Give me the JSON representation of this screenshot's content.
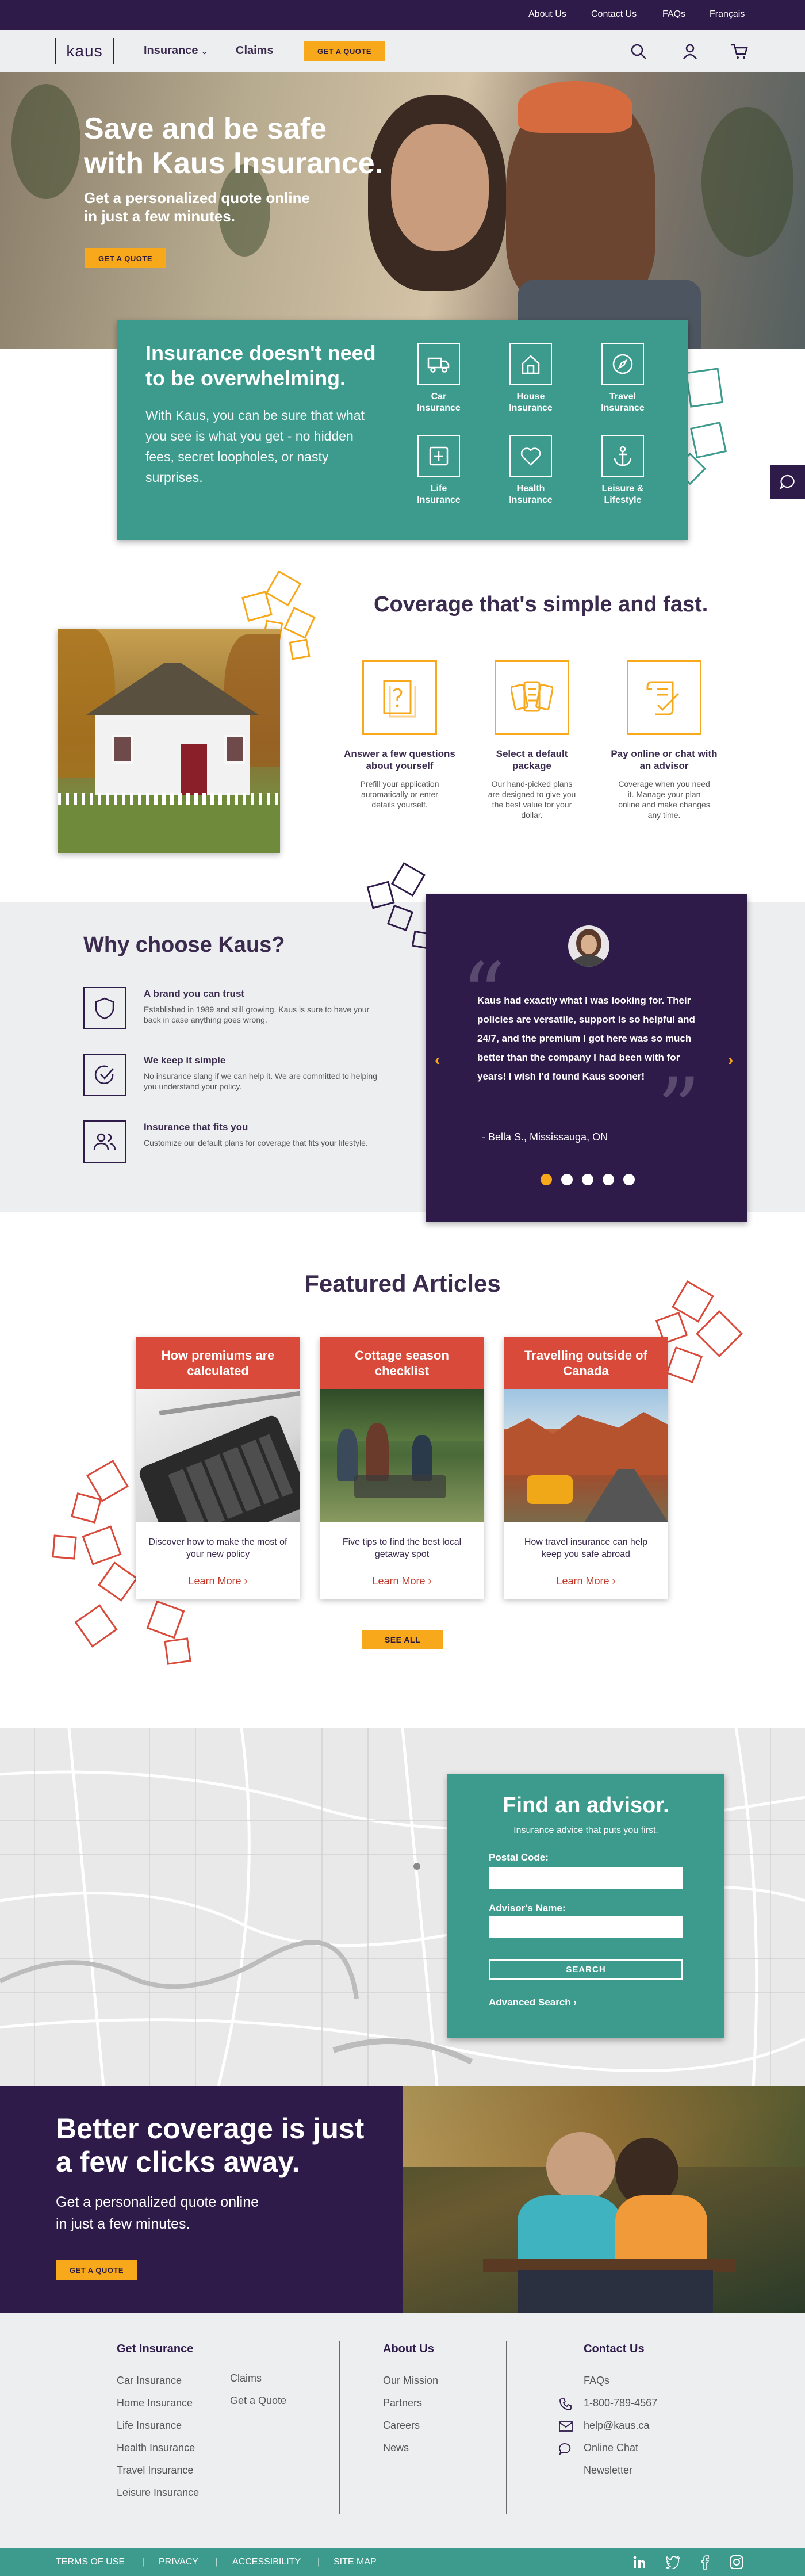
{
  "topbar": {
    "links": [
      "About Us",
      "Contact Us",
      "FAQs",
      "Français"
    ]
  },
  "nav": {
    "logo": "kaus",
    "insurance": "Insurance",
    "claims": "Claims",
    "cta": "GET A QUOTE"
  },
  "hero": {
    "title_line1": "Save and be safe",
    "title_line2": "with Kaus Insurance.",
    "subtitle_line1": "Get a personalized quote online",
    "subtitle_line2": "in just a few minutes.",
    "cta": "GET A QUOTE"
  },
  "insbox": {
    "title_line1": "Insurance doesn't need",
    "title_line2": "to be overwhelming.",
    "body": "With Kaus, you can be sure that what you see is what you get - no hidden fees, secret loopholes, or nasty surprises.",
    "items": [
      {
        "l1": "Car",
        "l2": "Insurance",
        "icon": "truck-icon"
      },
      {
        "l1": "House",
        "l2": "Insurance",
        "icon": "house-icon"
      },
      {
        "l1": "Travel",
        "l2": "Insurance",
        "icon": "compass-icon"
      },
      {
        "l1": "Life",
        "l2": "Insurance",
        "icon": "plus-square-icon"
      },
      {
        "l1": "Health",
        "l2": "Insurance",
        "icon": "heart-icon"
      },
      {
        "l1": "Leisure &",
        "l2": "Lifestyle",
        "icon": "anchor-icon"
      }
    ]
  },
  "coverage": {
    "title": "Coverage that's simple and fast.",
    "steps": [
      {
        "t1": "Answer a few questions",
        "t2": "about yourself",
        "d": "Prefill your application automatically or enter details yourself."
      },
      {
        "t1": "Select a default",
        "t2": "package",
        "d": "Our hand-picked plans are designed to give you the best value for your dollar."
      },
      {
        "t1": "Pay online or chat with",
        "t2": "an advisor",
        "d": "Coverage when you need it. Manage your plan online and make changes any time."
      }
    ]
  },
  "why": {
    "title": "Why choose Kaus?",
    "items": [
      {
        "t": "A brand you can trust",
        "d": "Established in 1989 and still growing, Kaus is sure to have your back in case anything goes wrong."
      },
      {
        "t": "We keep it simple",
        "d": "No insurance slang if we can help it. We are committed to helping you understand your policy."
      },
      {
        "t": "Insurance that fits you",
        "d": "Customize our default plans for coverage that fits your lifestyle."
      }
    ]
  },
  "testimonial": {
    "quote": "Kaus had exactly what I was looking for. Their policies are versatile, support is so helpful and 24/7, and the premium I got here was so much better than the company I had been with for years! I wish I'd found Kaus sooner!",
    "author": "- Bella S., Mississauga, ON",
    "dots": 5,
    "active_dot": 0
  },
  "articles": {
    "title": "Featured Articles",
    "cards": [
      {
        "h": "How premiums are calculated",
        "d": "Discover how to make the most of your new policy",
        "more": "Learn More"
      },
      {
        "h": "Cottage season checklist",
        "d": "Five tips to find the best local getaway spot",
        "more": "Learn More"
      },
      {
        "h": "Travelling outside of Canada",
        "d": "How travel insurance can help keep you safe abroad",
        "more": "Learn More"
      }
    ],
    "see_all": "SEE ALL"
  },
  "advisor": {
    "title": "Find an advisor.",
    "subtitle": "Insurance advice that puts you first.",
    "postal_label": "Postal Code:",
    "name_label": "Advisor's Name:",
    "search": "SEARCH",
    "advanced": "Advanced Search"
  },
  "better": {
    "title_line1": "Better coverage is just",
    "title_line2": "a few clicks away.",
    "sub_line1": "Get a personalized quote online",
    "sub_line2": "in just a few minutes.",
    "cta": "GET A QUOTE"
  },
  "footer": {
    "col1_title": "Get Insurance",
    "col1_a": [
      "Car Insurance",
      "Home Insurance",
      "Life Insurance",
      "Health Insurance",
      "Travel Insurance",
      "Leisure Insurance"
    ],
    "col1_b": [
      "Claims",
      "Get a Quote"
    ],
    "col2_title": "About Us",
    "col2": [
      "Our Mission",
      "Partners",
      "Careers",
      "News"
    ],
    "col3_title": "Contact Us",
    "faqs": "FAQs",
    "phone": "1-800-789-4567",
    "email": "help@kaus.ca",
    "chat": "Online Chat",
    "newsletter": "Newsletter"
  },
  "legal": {
    "links": [
      "TERMS OF USE",
      "PRIVACY",
      "ACCESSIBILITY",
      "SITE MAP"
    ]
  },
  "colors": {
    "purple": "#2f1b4a",
    "teal": "#3d9b8d",
    "yellow": "#f7a81b",
    "red": "#d94a3a"
  }
}
